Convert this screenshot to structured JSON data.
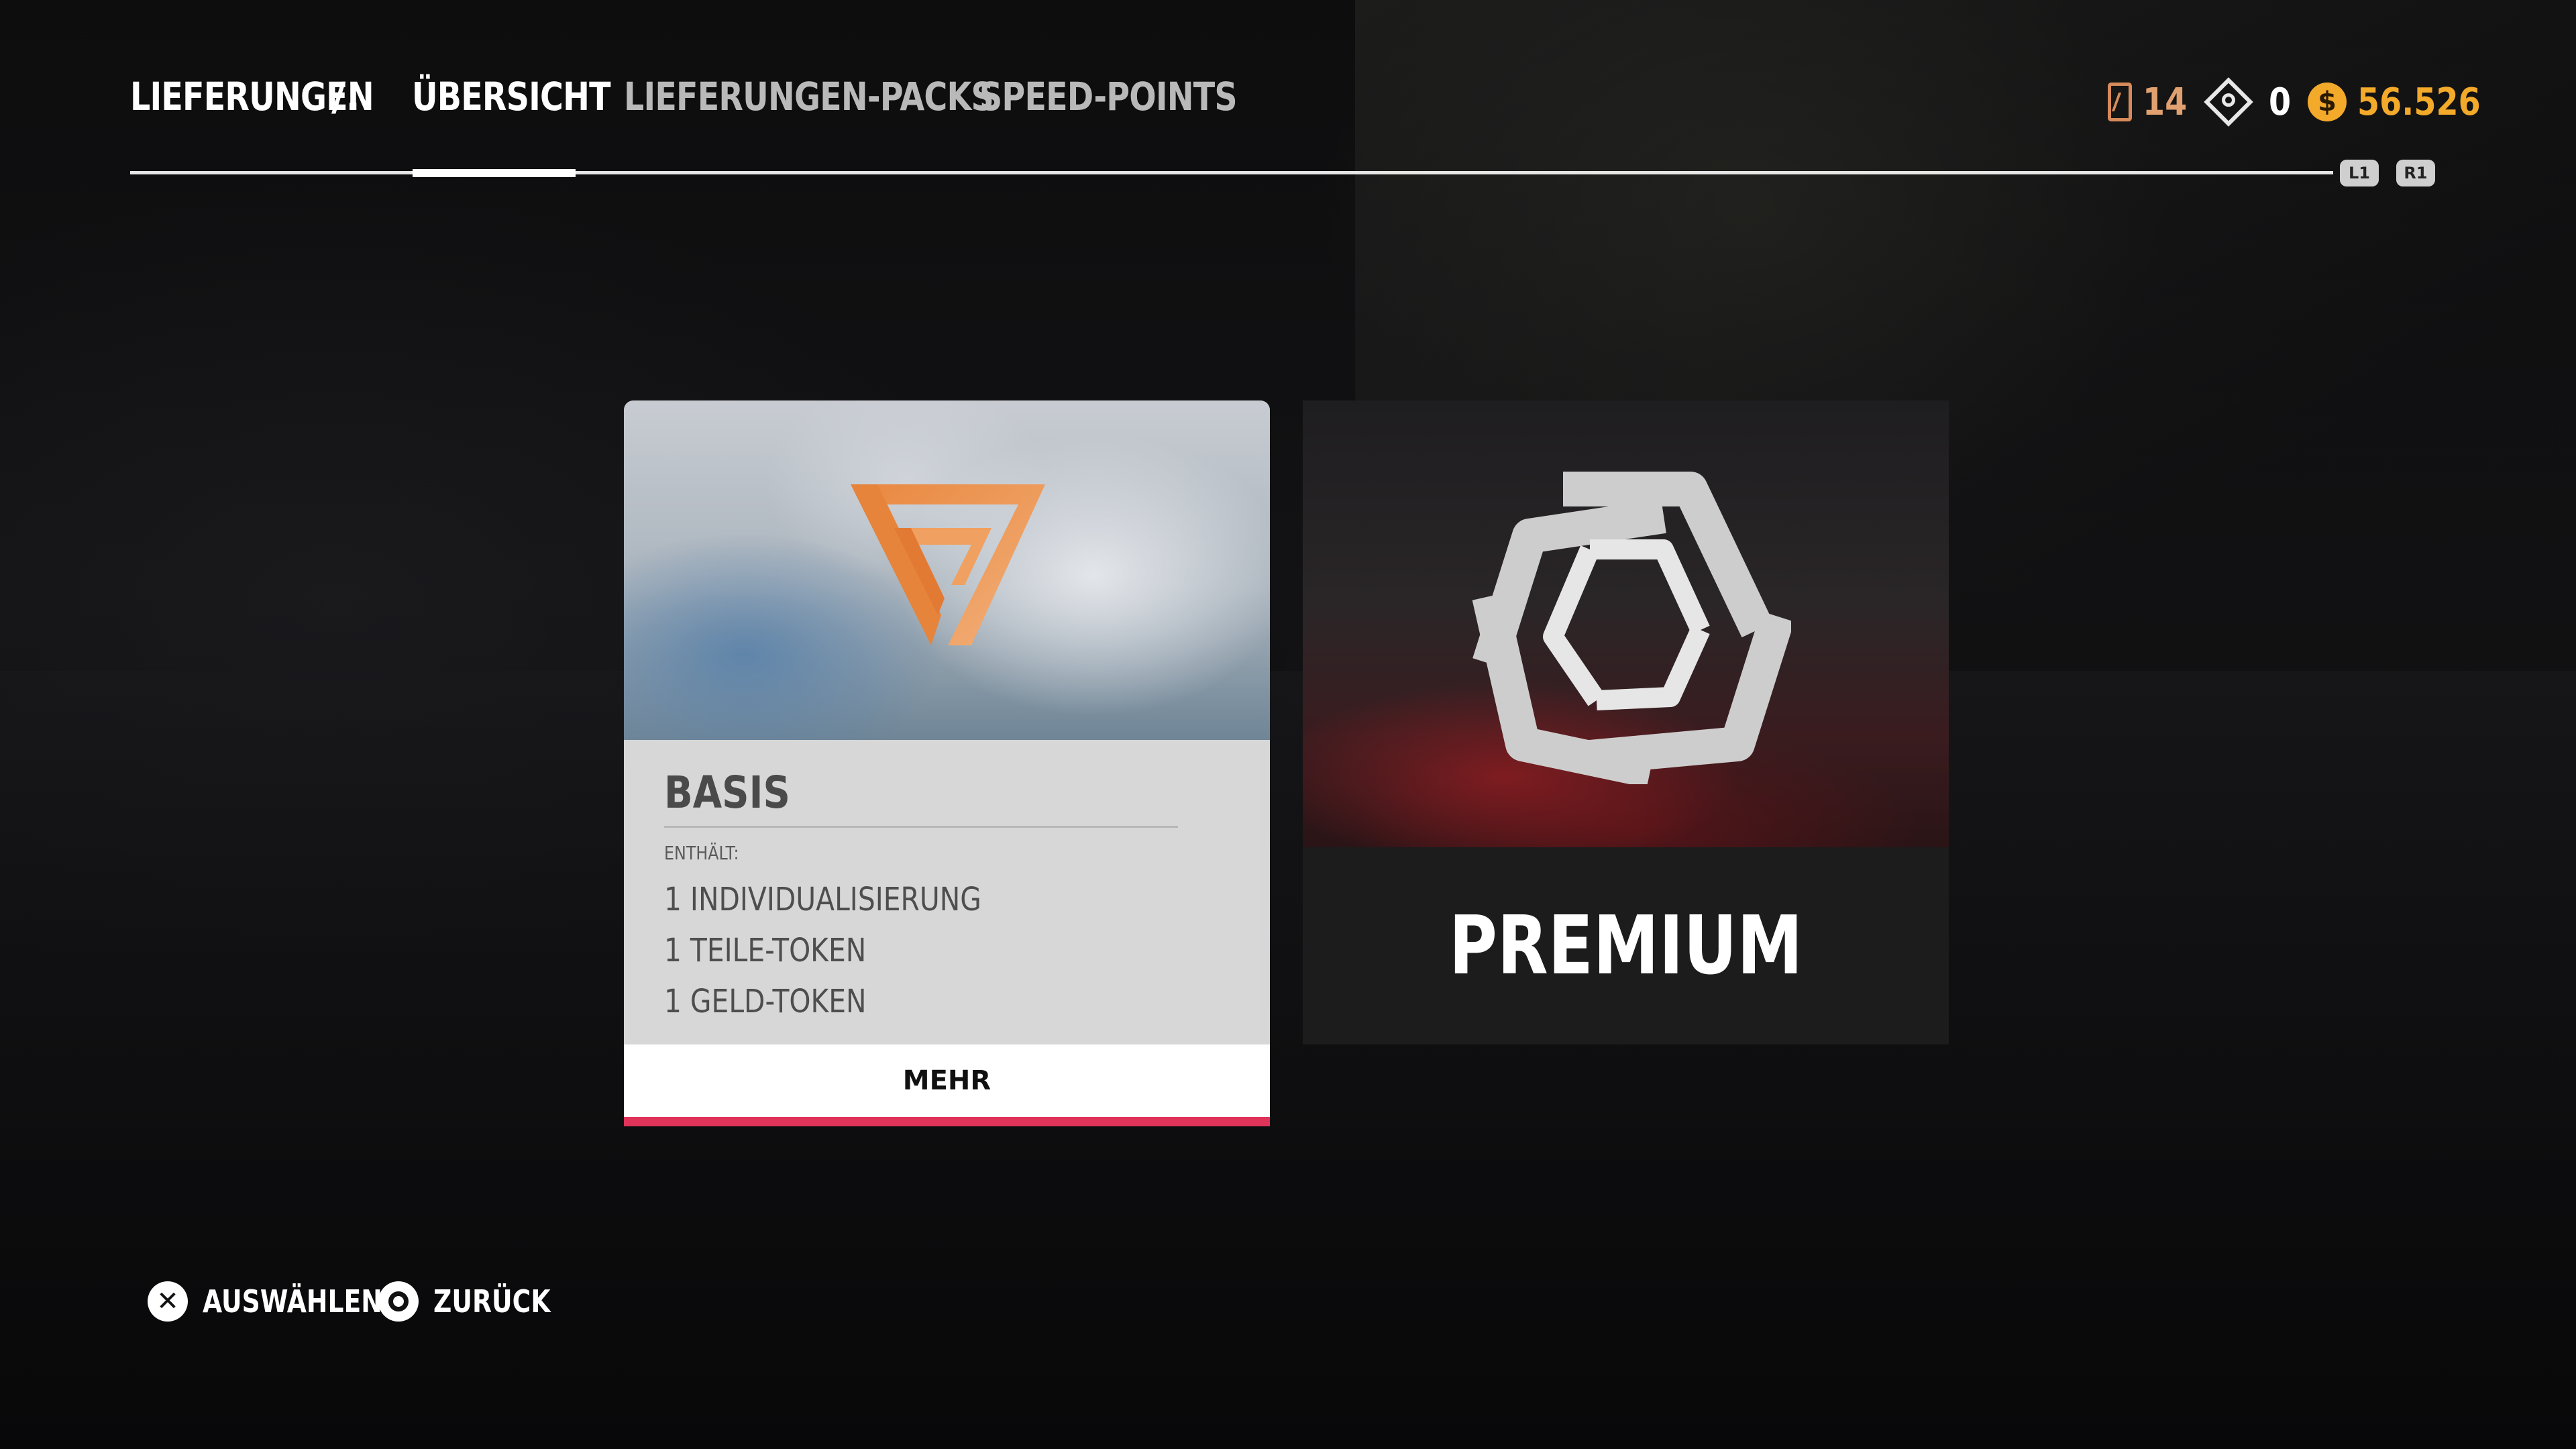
{
  "header": {
    "breadcrumb": "LIEFERUNGEN",
    "breadcrumb_separator": "/.",
    "tabs": [
      {
        "label": "ÜBERSICHT",
        "active": true
      },
      {
        "label": "LIEFERUNGEN-PACKS",
        "active": false
      },
      {
        "label": "SPEED-POINTS",
        "active": false
      }
    ],
    "shoulder_left": "L1",
    "shoulder_right": "R1"
  },
  "currency": {
    "cards": "14",
    "tokens": "0",
    "money": "56.526",
    "money_icon": "$"
  },
  "cards": {
    "basis": {
      "title": "BASIS",
      "contains_label": "ENTHÄLT:",
      "items": [
        "1 INDIVIDUALISIERUNG",
        "1 TEILE-TOKEN",
        "1 GELD-TOKEN"
      ],
      "more_label": "MEHR",
      "icon": "basis-triangle-logo-icon",
      "accent_color": "#e0335a",
      "logo_color": "#e8894a"
    },
    "premium": {
      "title": "PREMIUM",
      "icon": "premium-pentagon-logo-icon",
      "logo_color": "#cfcfcf"
    }
  },
  "prompts": {
    "select_label": "AUSWÄHLEN",
    "back_label": "ZURÜCK"
  }
}
